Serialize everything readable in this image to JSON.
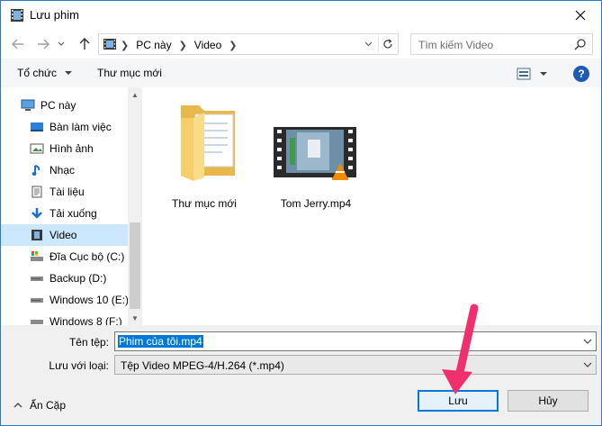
{
  "window": {
    "title": "Lưu phim",
    "close_label": "✕"
  },
  "nav": {
    "breadcrumbs": [
      "PC này",
      "Video"
    ],
    "search_placeholder": "Tìm kiếm Video"
  },
  "toolbar": {
    "organize": "Tổ chức",
    "new_folder": "Thư mục mới",
    "help": "?"
  },
  "sidebar": {
    "items": [
      {
        "label": "PC này",
        "icon": "pc-icon"
      },
      {
        "label": "Bàn làm việc",
        "icon": "desktop-icon"
      },
      {
        "label": "Hình ảnh",
        "icon": "pictures-icon"
      },
      {
        "label": "Nhạc",
        "icon": "music-icon"
      },
      {
        "label": "Tài liệu",
        "icon": "documents-icon"
      },
      {
        "label": "Tải xuống",
        "icon": "downloads-icon"
      },
      {
        "label": "Video",
        "icon": "videos-icon",
        "selected": true
      },
      {
        "label": "Đĩa Cục bộ (C:)",
        "icon": "drive-c-icon"
      },
      {
        "label": "Backup (D:)",
        "icon": "drive-icon"
      },
      {
        "label": "Windows 10 (E:)",
        "icon": "drive-icon"
      },
      {
        "label": "Windows 8 (F:)",
        "icon": "drive-icon"
      }
    ]
  },
  "content": {
    "items": [
      {
        "label": "Thư mục mới",
        "icon": "folder-icon"
      },
      {
        "label": "Tom Jerry.mp4",
        "icon": "video-file-icon"
      }
    ]
  },
  "form": {
    "filename_label": "Tên tệp:",
    "filename_value": "Phim của tôi.mp4",
    "type_label": "Lưu với loại:",
    "type_value": "Tệp Video MPEG-4/H.264 (*.mp4)"
  },
  "footer": {
    "hide_folders": "Ẩn Cặp",
    "save": "Lưu",
    "cancel": "Hủy"
  },
  "colors": {
    "accent": "#0078d7",
    "selection": "#cce8ff",
    "annotation_arrow": "#f0306e"
  }
}
